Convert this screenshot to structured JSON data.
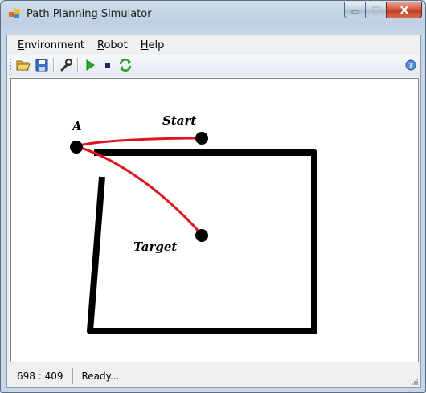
{
  "window": {
    "title": "Path Planning Simulator"
  },
  "menu": {
    "items": [
      {
        "label": "Environment",
        "ul": "E",
        "rest": "nvironment"
      },
      {
        "label": "Robot",
        "ul": "R",
        "rest": "obot"
      },
      {
        "label": "Help",
        "ul": "H",
        "rest": "elp"
      }
    ]
  },
  "toolbar": {
    "icons": [
      "open-folder-icon",
      "save-icon",
      "wrench-icon",
      "play-icon",
      "stop-icon",
      "refresh-icon",
      "help-icon"
    ]
  },
  "canvas": {
    "labels": {
      "a": "A",
      "start": "Start",
      "target": "Target"
    },
    "colors": {
      "path": "#e0141c",
      "obstacle": "#000000",
      "point": "#000000"
    }
  },
  "status": {
    "coords": "698 : 409",
    "text": "Ready..."
  }
}
